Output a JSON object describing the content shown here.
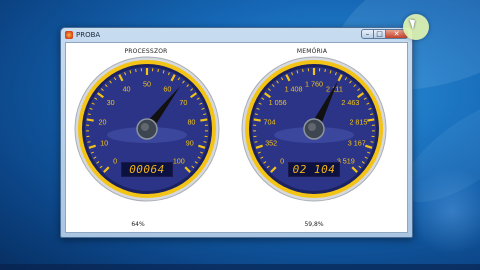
{
  "window": {
    "title": "PROBA",
    "minimize_glyph": "–",
    "maximize_glyph": "□",
    "close_glyph": "✕"
  },
  "gauges": [
    {
      "title": "PROCESSZOR",
      "ticks": [
        "0",
        "10",
        "20",
        "30",
        "40",
        "50",
        "60",
        "70",
        "80",
        "90",
        "100"
      ],
      "odometer": "00064",
      "needle_fraction": 0.64,
      "percent_label": "64%"
    },
    {
      "title": "MEMÓRIA",
      "ticks": [
        "0",
        "352",
        "704",
        "1 056",
        "1 408",
        "1 760",
        "2 111",
        "2 463",
        "2 815",
        "3 167",
        "3 519"
      ],
      "odometer": "02 104",
      "needle_fraction": 0.598,
      "percent_label": "59,8%"
    }
  ],
  "colors": {
    "dial_face": "#2b3486",
    "dial_rim": "#f3c316",
    "tick_text": "#f3c316",
    "needle": "#111111"
  },
  "icons": {
    "app": "app-icon",
    "cursor": "mouse-cursor-icon"
  }
}
